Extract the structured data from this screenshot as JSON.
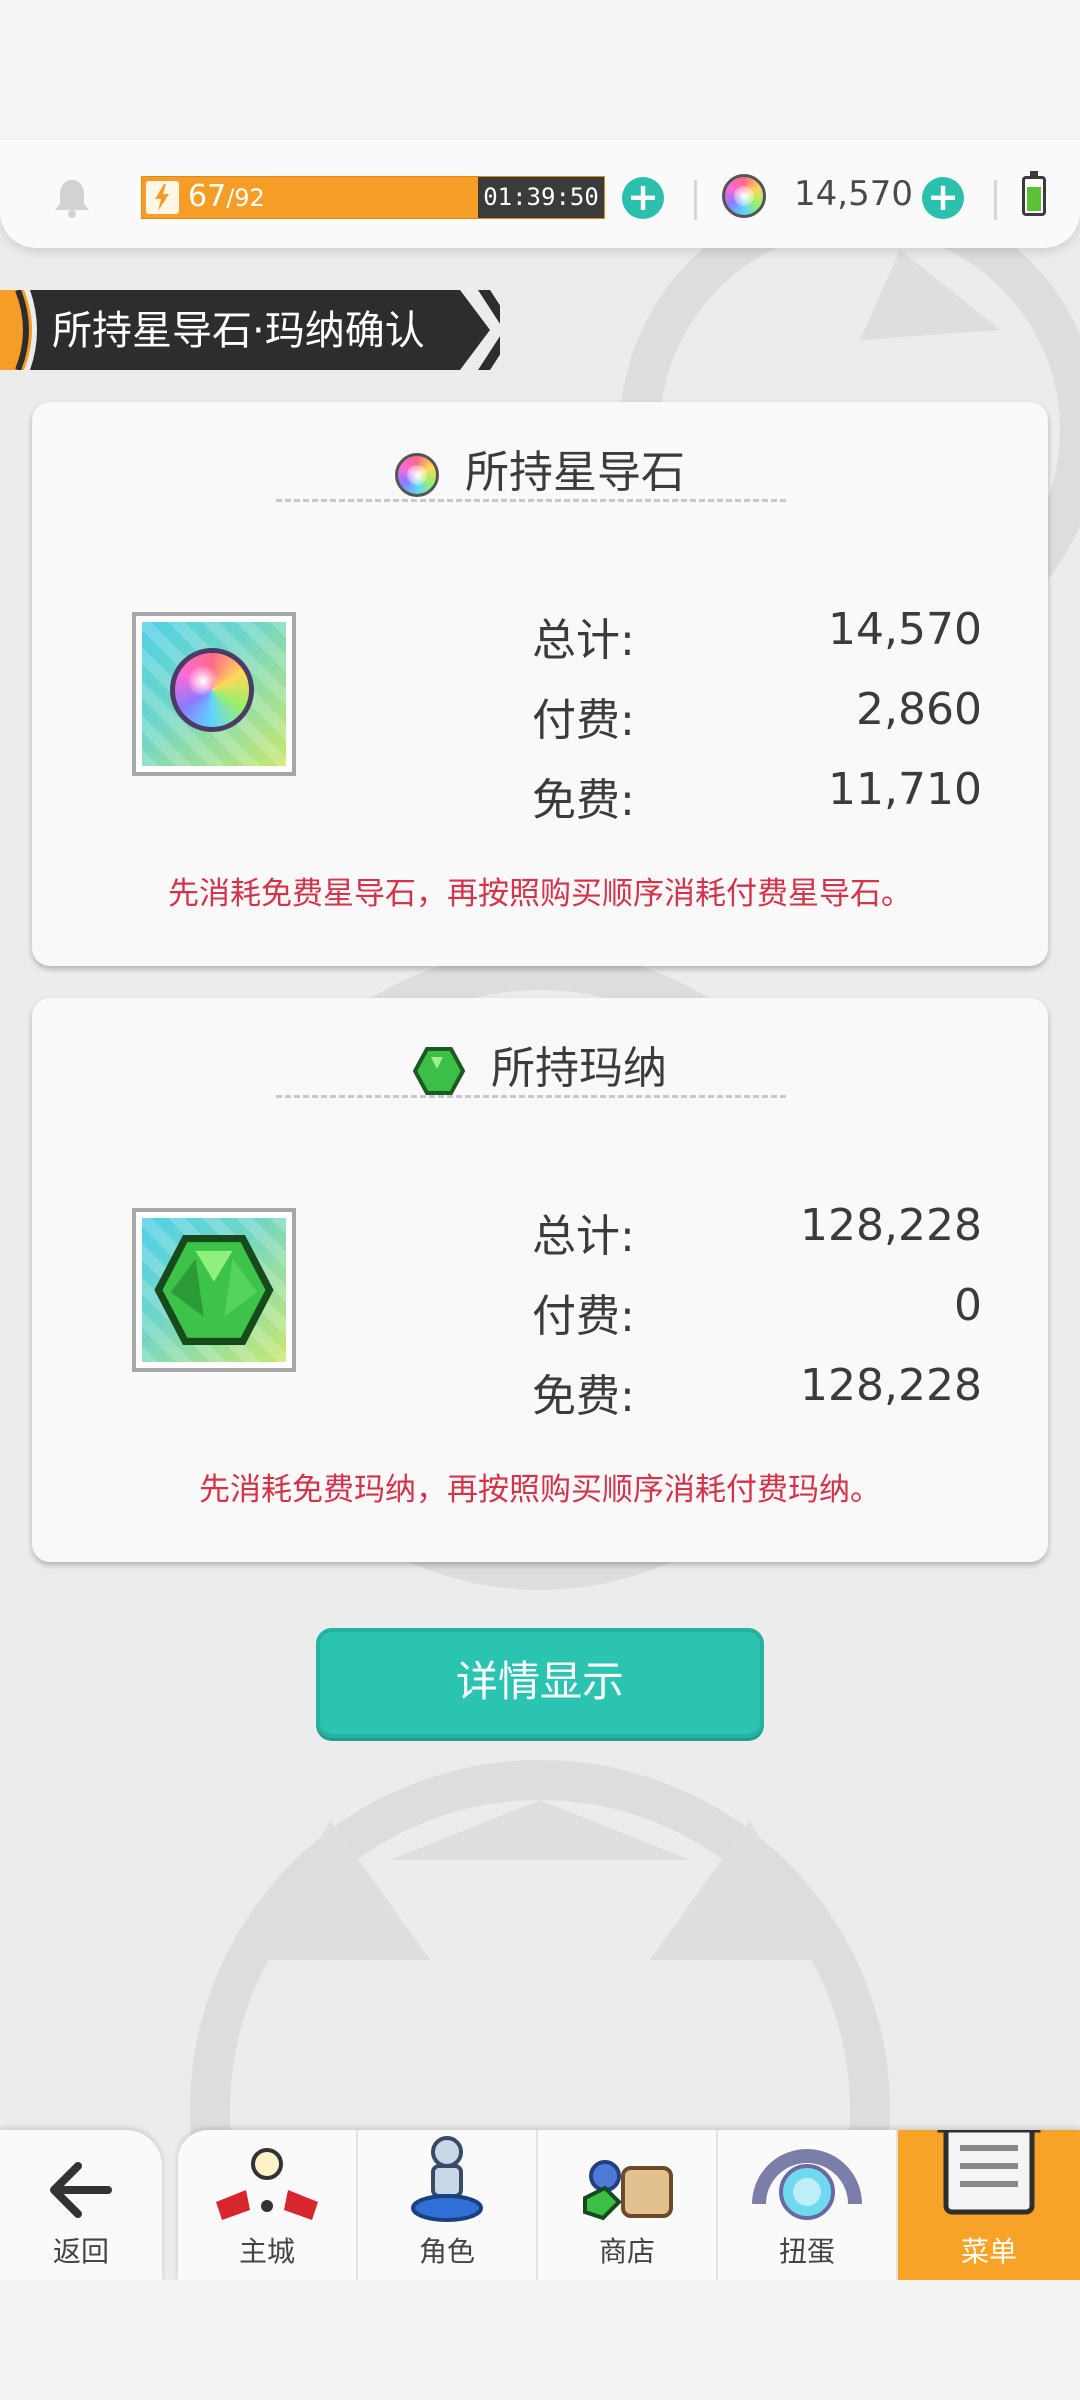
{
  "topbar": {
    "stamina_current": "67",
    "stamina_max": "/92",
    "stamina_fill": 0.73,
    "stamina_timer": "01:39:50",
    "gem_count": "14,570",
    "battery_level": 0.7
  },
  "section": {
    "title": "所持星导石·玛纳确认"
  },
  "star_stone_card": {
    "title": "所持星导石",
    "total_label": "总计:",
    "total_value": "14,570",
    "paid_label": "付费:",
    "paid_value": "2,860",
    "free_label": "免费:",
    "free_value": "11,710",
    "note": "先消耗免费星导石，再按照购买顺序消耗付费星导石。"
  },
  "mana_card": {
    "title": "所持玛纳",
    "total_label": "总计:",
    "total_value": "128,228",
    "paid_label": "付费:",
    "paid_value": "0",
    "free_label": "免费:",
    "free_value": "128,228",
    "note": "先消耗免费玛纳，再按照购买顺序消耗付费玛纳。"
  },
  "detail_button": {
    "label": "详情显示"
  },
  "nav": {
    "back": "返回",
    "items": [
      {
        "label": "主城",
        "icon": "castle-icon"
      },
      {
        "label": "角色",
        "icon": "character-icon"
      },
      {
        "label": "商店",
        "icon": "shop-icon"
      },
      {
        "label": "扭蛋",
        "icon": "gacha-icon"
      },
      {
        "label": "菜单",
        "icon": "menu-icon"
      }
    ],
    "active_index": 4
  },
  "colors": {
    "accent_teal": "#2bc4b0",
    "stamina_orange": "#f59d27",
    "note_red": "#d4334a",
    "active_tab": "#f7a327"
  }
}
